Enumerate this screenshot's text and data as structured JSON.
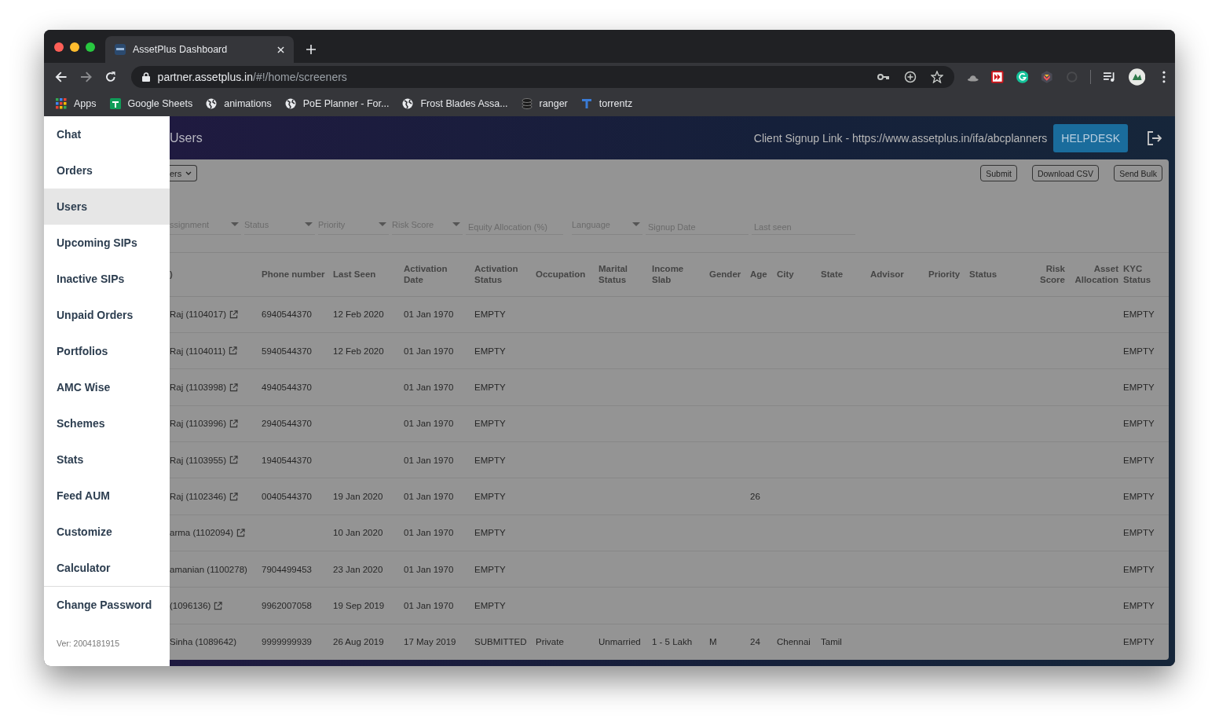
{
  "browser": {
    "tabs": [
      {
        "title": "AssetPlus Dashboard",
        "selected": true
      }
    ],
    "url": {
      "host": "partner.assetplus.in",
      "path": "/#!/home/screeners"
    },
    "bookmarks": [
      {
        "label": "Apps",
        "kind": "apps"
      },
      {
        "label": "Google Sheets",
        "kind": "sheets"
      },
      {
        "label": "animations",
        "kind": "globe"
      },
      {
        "label": "PoE Planner - For...",
        "kind": "globe"
      },
      {
        "label": "Frost Blades Assa...",
        "kind": "globe"
      },
      {
        "label": "ranger",
        "kind": "coins"
      },
      {
        "label": "torrentz",
        "kind": "torrent"
      }
    ]
  },
  "sidebar": {
    "items": [
      {
        "label": "Chat",
        "selected": false
      },
      {
        "label": "Orders",
        "selected": false
      },
      {
        "label": "Users",
        "selected": true
      },
      {
        "label": "Upcoming SIPs",
        "selected": false
      },
      {
        "label": "Inactive SIPs",
        "selected": false
      },
      {
        "label": "Unpaid Orders",
        "selected": false
      },
      {
        "label": "Portfolios",
        "selected": false
      },
      {
        "label": "AMC Wise",
        "selected": false
      },
      {
        "label": "Schemes",
        "selected": false
      },
      {
        "label": "Stats",
        "selected": false
      },
      {
        "label": "Feed AUM",
        "selected": false
      },
      {
        "label": "Customize",
        "selected": false
      },
      {
        "label": "Calculator",
        "selected": false
      },
      {
        "label": "Change Password",
        "selected": false
      }
    ],
    "version": "Ver: 2004181915"
  },
  "header": {
    "title": "Users",
    "signup_link": "Client Signup Link - https://www.assetplus.in/ifa/abcplanners",
    "helpdesk": "HELPDESK"
  },
  "toolbar": {
    "dropdown": "ers",
    "buttons": [
      "Submit",
      "Download CSV",
      "Send Bulk"
    ]
  },
  "filters": [
    {
      "kind": "select",
      "placeholder": "ssignment"
    },
    {
      "kind": "select",
      "placeholder": "Status"
    },
    {
      "kind": "select",
      "placeholder": "Priority"
    },
    {
      "kind": "select",
      "placeholder": "Risk Score"
    },
    {
      "kind": "input",
      "placeholder": "Equity Allocation (%)"
    },
    {
      "kind": "select",
      "placeholder": "Language"
    },
    {
      "kind": "input",
      "placeholder": "Signup Date"
    },
    {
      "kind": "input",
      "placeholder": "Last seen"
    }
  ],
  "table": {
    "columns": [
      {
        "label": ")"
      },
      {
        "label": "Phone number"
      },
      {
        "label": "Last Seen"
      },
      {
        "label": "Activation Date"
      },
      {
        "label": "Activation Status"
      },
      {
        "label": "Occupation"
      },
      {
        "label": "Marital Status"
      },
      {
        "label": "Income Slab"
      },
      {
        "label": "Gender"
      },
      {
        "label": "Age"
      },
      {
        "label": "City"
      },
      {
        "label": "State"
      },
      {
        "label": "Advisor"
      },
      {
        "label": "Priority"
      },
      {
        "label": "Status"
      },
      {
        "label": "Risk Score"
      },
      {
        "label": "Asset Allocation"
      },
      {
        "label": "KYC Status"
      }
    ],
    "rows": [
      {
        "link": true,
        "cells": [
          "Raj (1104017)",
          "6940544370",
          "12 Feb 2020",
          "01 Jan 1970",
          "EMPTY",
          null,
          null,
          null,
          null,
          null,
          null,
          null,
          null,
          null,
          null,
          null,
          null,
          "EMPTY"
        ]
      },
      {
        "link": true,
        "cells": [
          "Raj (1104011)",
          "5940544370",
          "12 Feb 2020",
          "01 Jan 1970",
          "EMPTY",
          null,
          null,
          null,
          null,
          null,
          null,
          null,
          null,
          null,
          null,
          null,
          null,
          "EMPTY"
        ]
      },
      {
        "link": true,
        "cells": [
          "Raj (1103998)",
          "4940544370",
          null,
          "01 Jan 1970",
          "EMPTY",
          null,
          null,
          null,
          null,
          null,
          null,
          null,
          null,
          null,
          null,
          null,
          null,
          "EMPTY"
        ]
      },
      {
        "link": true,
        "cells": [
          "Raj (1103996)",
          "2940544370",
          null,
          "01 Jan 1970",
          "EMPTY",
          null,
          null,
          null,
          null,
          null,
          null,
          null,
          null,
          null,
          null,
          null,
          null,
          "EMPTY"
        ]
      },
      {
        "link": true,
        "cells": [
          "Raj (1103955)",
          "1940544370",
          null,
          "01 Jan 1970",
          "EMPTY",
          null,
          null,
          null,
          null,
          null,
          null,
          null,
          null,
          null,
          null,
          null,
          null,
          "EMPTY"
        ]
      },
      {
        "link": true,
        "cells": [
          "Raj (1102346)",
          "0040544370",
          "19 Jan 2020",
          "01 Jan 1970",
          "EMPTY",
          null,
          null,
          null,
          null,
          "26",
          null,
          null,
          null,
          null,
          null,
          null,
          null,
          "EMPTY"
        ]
      },
      {
        "link": true,
        "cells": [
          "arma (1102094)",
          null,
          "10 Jan 2020",
          "01 Jan 1970",
          "EMPTY",
          null,
          null,
          null,
          null,
          null,
          null,
          null,
          null,
          null,
          null,
          null,
          null,
          "EMPTY"
        ]
      },
      {
        "link": false,
        "cells": [
          "amanian (1100278)",
          "7904499453",
          "23 Jan 2020",
          "01 Jan 1970",
          "EMPTY",
          null,
          null,
          null,
          null,
          null,
          null,
          null,
          null,
          null,
          null,
          null,
          null,
          "EMPTY"
        ]
      },
      {
        "link": true,
        "cells": [
          "(1096136)",
          "9962007058",
          "19 Sep 2019",
          "01 Jan 1970",
          "EMPTY",
          null,
          null,
          null,
          null,
          null,
          null,
          null,
          null,
          null,
          null,
          null,
          null,
          "EMPTY"
        ]
      },
      {
        "link": false,
        "cells": [
          "Sinha (1089642)",
          "9999999939",
          "26 Aug 2019",
          "17 May 2019",
          "SUBMITTED",
          "Private",
          "Unmarried",
          "1 - 5 Lakh",
          "M",
          "24",
          "Chennai",
          "Tamil",
          null,
          null,
          null,
          null,
          null,
          "EMPTY"
        ]
      }
    ]
  }
}
